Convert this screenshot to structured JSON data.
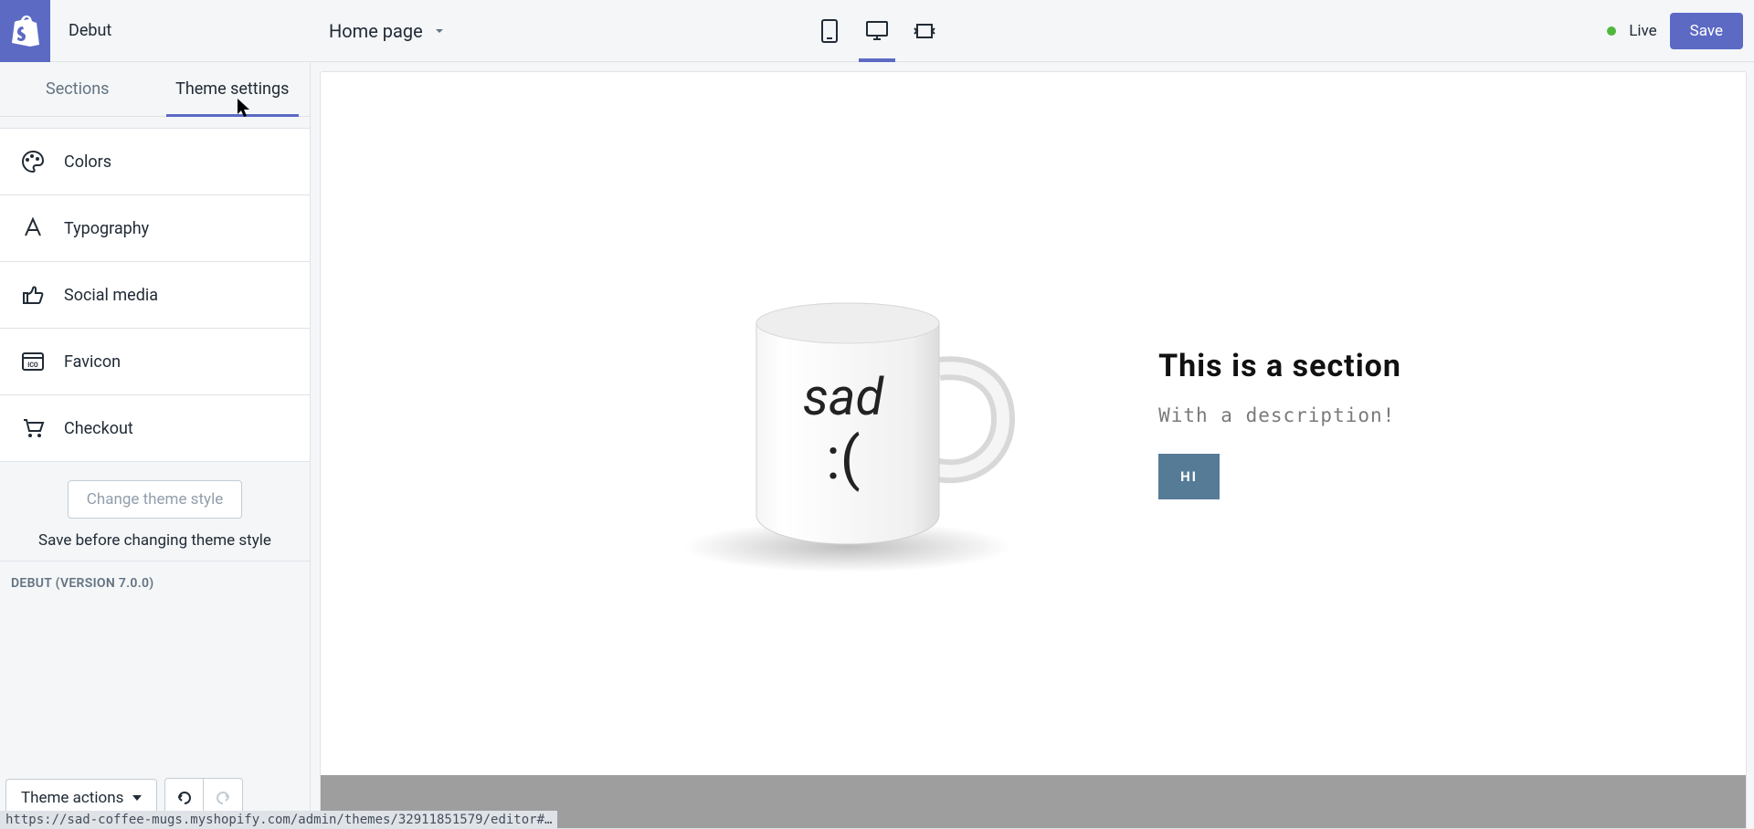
{
  "header": {
    "theme_name": "Debut",
    "page_select_label": "Home page",
    "live_label": "Live",
    "save_label": "Save"
  },
  "tabs": {
    "sections": "Sections",
    "theme_settings": "Theme settings"
  },
  "settings": [
    {
      "icon": "palette-icon",
      "label": "Colors"
    },
    {
      "icon": "typography-icon",
      "label": "Typography"
    },
    {
      "icon": "thumbs-up-icon",
      "label": "Social media"
    },
    {
      "icon": "favicon-icon",
      "label": "Favicon"
    },
    {
      "icon": "cart-icon",
      "label": "Checkout"
    }
  ],
  "sidebar_lower": {
    "change_style": "Change theme style",
    "save_hint": "Save before changing theme style",
    "version": "DEBUT (VERSION 7.0.0)"
  },
  "sidebar_footer": {
    "theme_actions": "Theme actions"
  },
  "preview": {
    "mug_text_line1": "sad",
    "mug_text_line2": ":(",
    "section_heading": "This is a section",
    "section_desc": "With a description!",
    "button_label": "HI"
  },
  "status_url": "https://sad-coffee-mugs.myshopify.com/admin/themes/32911851579/editor#…"
}
